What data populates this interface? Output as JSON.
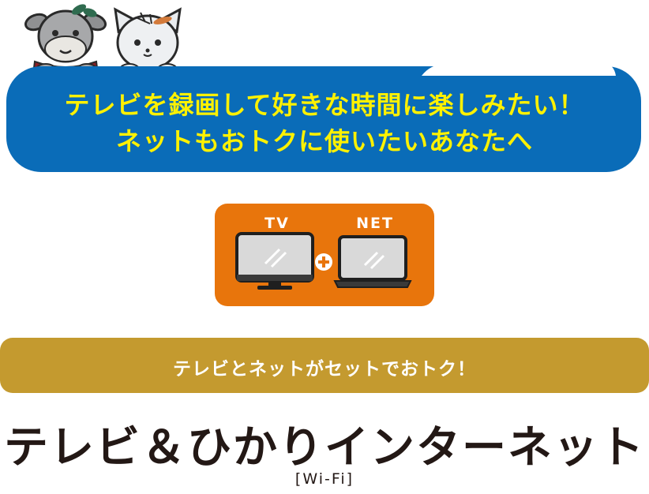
{
  "banner": {
    "line1": "テレビを録画して好きな時間に楽しみたい！",
    "line2": "ネットもおトクに使いたいあなたへ"
  },
  "card": {
    "tv_label": "TV",
    "net_label": "NET",
    "tv_icon": "tv-icon",
    "plus_icon": "plus-icon",
    "laptop_icon": "laptop-icon"
  },
  "strip": {
    "text": "テレビとネットがセットでおトク！"
  },
  "product": {
    "name": "テレビ＆ひかりインターネット",
    "sub": "[Wi-Fi]"
  },
  "colors": {
    "banner_blue": "#0a6cb8",
    "banner_text_yellow": "#fff100",
    "card_orange": "#e8750c",
    "strip_gold": "#c49a2f",
    "title_dark": "#231815"
  }
}
